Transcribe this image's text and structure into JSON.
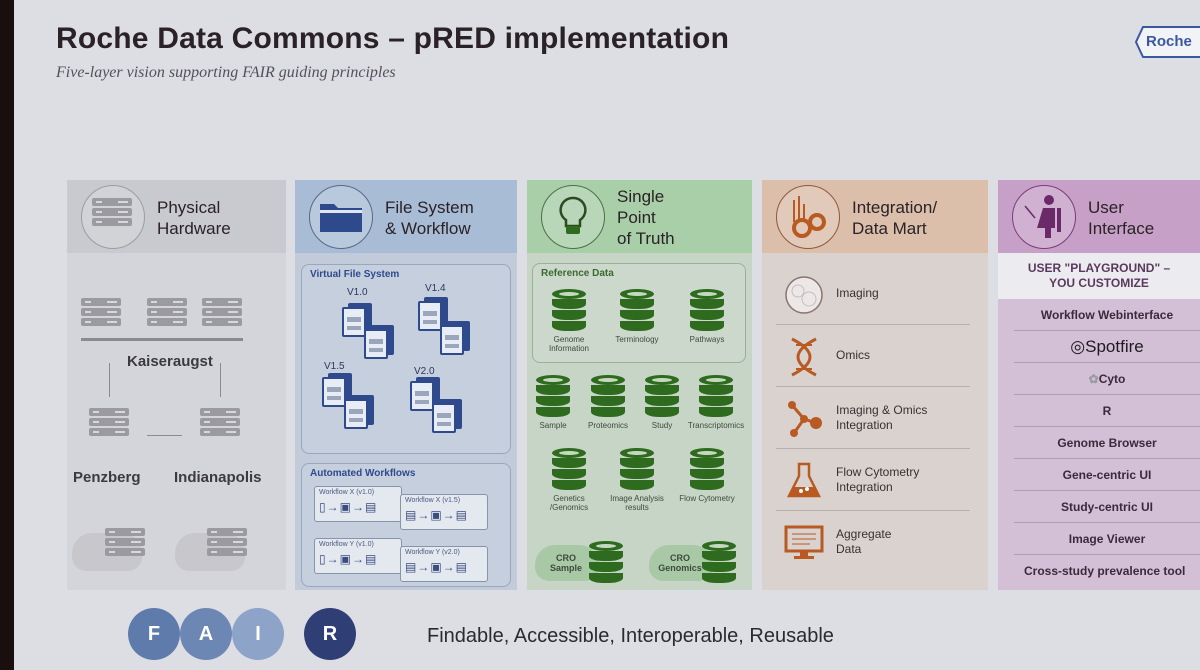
{
  "slide": {
    "title": "Roche Data Commons – pRED implementation",
    "subtitle": "Five-layer vision supporting FAIR guiding principles",
    "logo": "Roche"
  },
  "columns": {
    "hardware": {
      "title_line1": "Physical",
      "title_line2": "Hardware",
      "icon": "server-rack-icon",
      "sites": [
        "Kaiseraugst",
        "Penzberg",
        "Indianapolis"
      ]
    },
    "filesystem": {
      "title_line1": "File System",
      "title_line2": "& Workflow",
      "icon": "folder-icon",
      "virtual_fs": {
        "title": "Virtual File System",
        "versions": [
          "V1.0",
          "V1.4",
          "V1.5",
          "V2.0"
        ]
      },
      "workflows": {
        "title": "Automated Workflows",
        "items": [
          "Workflow X (v1.0)",
          "Workflow X (v1.5)",
          "Workflow Y (v1.0)",
          "Workflow Y (v2.0)"
        ]
      }
    },
    "truth": {
      "title_line1": "Single",
      "title_line2": "Point",
      "title_line3": "of Truth",
      "icon": "lightbulb-icon",
      "reference": {
        "title": "Reference Data",
        "items": [
          "Genome Information",
          "Terminology",
          "Pathways"
        ]
      },
      "data_row1": [
        "Sample",
        "Proteomics",
        "Study",
        "Transcriptomics"
      ],
      "data_row2": [
        "Genetics /Genomics",
        "Image Analysis results",
        "Flow Cytometry"
      ],
      "cro": [
        "CRO Sample",
        "CRO Genomics"
      ]
    },
    "datamart": {
      "title_line1": "Integration/",
      "title_line2": "Data Mart",
      "icon": "chart-gears-icon",
      "items": [
        {
          "l1": "Imaging",
          "l2": "",
          "icon": "cell-image-icon"
        },
        {
          "l1": "Omics",
          "l2": "",
          "icon": "dna-icon"
        },
        {
          "l1": "Imaging &  Omics",
          "l2": "Integration",
          "icon": "molecule-icon"
        },
        {
          "l1": "Flow Cytometry",
          "l2": "Integration",
          "icon": "flask-icon"
        },
        {
          "l1": "Aggregate",
          "l2": "Data",
          "icon": "monitor-icon"
        }
      ]
    },
    "ui": {
      "title_line1": "User",
      "title_line2": "Interface",
      "icon": "user-laptop-icon",
      "playground_l1": "USER \"PLAYGROUND\" –",
      "playground_l2": "YOU CUSTOMIZE",
      "items": [
        "Workflow Webinterface",
        "Spotfire",
        "Cyto",
        "R",
        "Genome Browser",
        "Gene-centric UI",
        "Study-centric UI",
        "Image Viewer",
        "Cross-study prevalence tool"
      ]
    }
  },
  "fair": {
    "letters": [
      "F",
      "A",
      "I",
      "R"
    ],
    "colors": [
      "#5f7bab",
      "#6d87b5",
      "#8ea3c8",
      "#2f3f76"
    ],
    "words": [
      "Findable",
      "Accessible",
      "Interoperable",
      "Reusable"
    ],
    "text": "Findable, Accessible, Interoperable, Reusable"
  }
}
